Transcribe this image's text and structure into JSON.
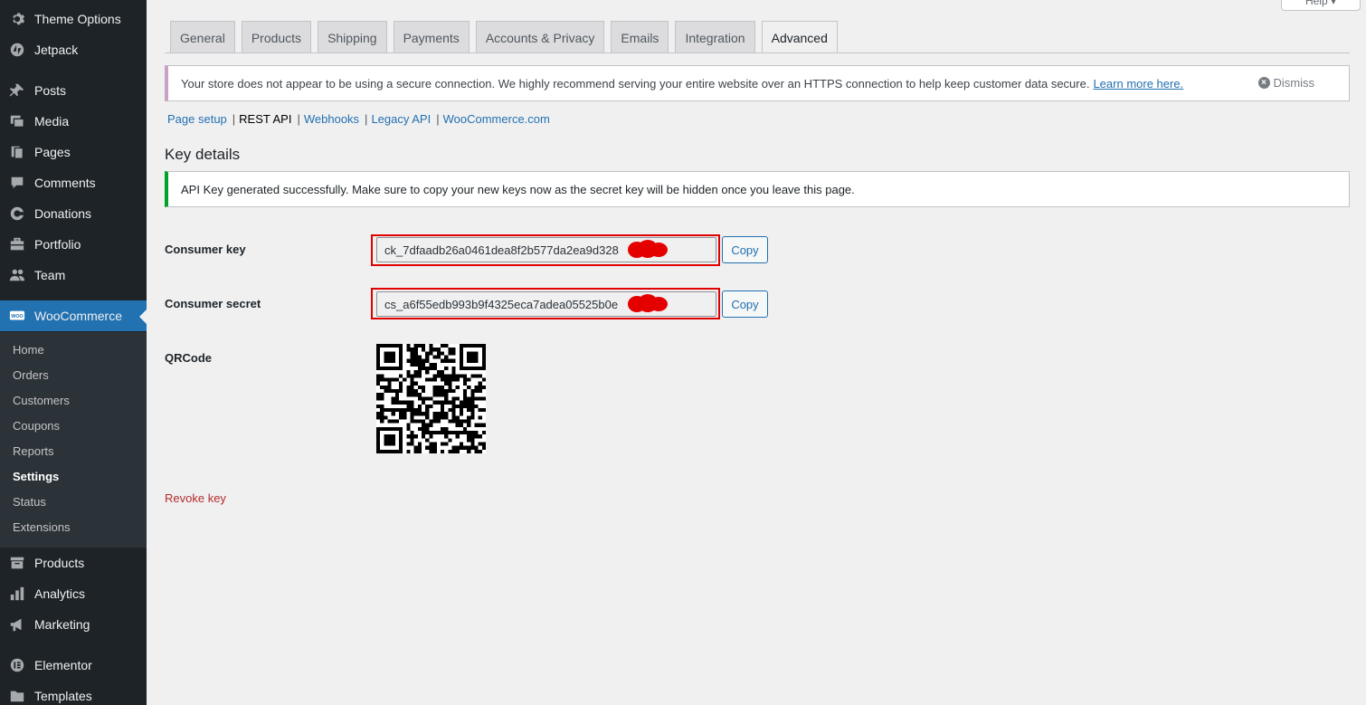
{
  "sidebar": {
    "items": [
      {
        "label": "Theme Options",
        "icon": "gear-icon"
      },
      {
        "label": "Jetpack",
        "icon": "jetpack-icon"
      },
      {
        "label": "Posts",
        "icon": "pin-icon"
      },
      {
        "label": "Media",
        "icon": "media-icon"
      },
      {
        "label": "Pages",
        "icon": "pages-icon"
      },
      {
        "label": "Comments",
        "icon": "comment-icon"
      },
      {
        "label": "Donations",
        "icon": "donation-icon"
      },
      {
        "label": "Portfolio",
        "icon": "portfolio-icon"
      },
      {
        "label": "Team",
        "icon": "team-icon"
      },
      {
        "label": "WooCommerce",
        "icon": "woo-icon"
      },
      {
        "label": "Products",
        "icon": "archive-icon"
      },
      {
        "label": "Analytics",
        "icon": "bar-chart-icon"
      },
      {
        "label": "Marketing",
        "icon": "megaphone-icon"
      },
      {
        "label": "Elementor",
        "icon": "elementor-icon"
      },
      {
        "label": "Templates",
        "icon": "folder-icon"
      }
    ],
    "woo_submenu": [
      "Home",
      "Orders",
      "Customers",
      "Coupons",
      "Reports",
      "Settings",
      "Status",
      "Extensions"
    ],
    "current_submenu": "Settings"
  },
  "help_label": "Help",
  "tabs": [
    "General",
    "Products",
    "Shipping",
    "Payments",
    "Accounts & Privacy",
    "Emails",
    "Integration",
    "Advanced"
  ],
  "active_tab": "Advanced",
  "https_notice": {
    "text": "Your store does not appear to be using a secure connection. We highly recommend serving your entire website over an HTTPS connection to help keep customer data secure.",
    "link": "Learn more here.",
    "dismiss": "Dismiss"
  },
  "sections": {
    "page_setup": "Page setup",
    "rest_api": "REST API",
    "webhooks": "Webhooks",
    "legacy_api": "Legacy API",
    "woocommerce_com": "WooCommerce.com"
  },
  "key_details": {
    "title": "Key details",
    "success_notice": "API Key generated successfully. Make sure to copy your new keys now as the secret key will be hidden once you leave this page.",
    "consumer_key_label": "Consumer key",
    "consumer_key_value": "ck_7dfaadb26a0461dea8f2b577da2ea9d328",
    "consumer_secret_label": "Consumer secret",
    "consumer_secret_value": "cs_a6f55edb993b9f4325eca7adea05525b0e",
    "copy_label": "Copy",
    "qrcode_label": "QRCode",
    "revoke_label": "Revoke key"
  },
  "colors": {
    "sidebar_bg": "#1d2327",
    "woo_active": "#2271b1",
    "highlight_box": "#e00000",
    "success_border": "#00a32a",
    "revoke_link": "#b32d2e"
  }
}
